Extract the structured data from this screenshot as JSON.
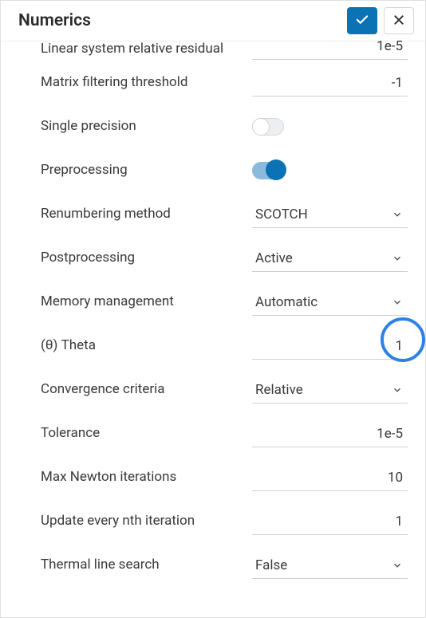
{
  "header": {
    "title": "Numerics"
  },
  "rows": {
    "linear_residual": {
      "label": "Linear system relative residual",
      "value": "1e-5"
    },
    "matrix_filter": {
      "label": "Matrix filtering threshold",
      "value": "-1"
    },
    "single_precision": {
      "label": "Single precision"
    },
    "preprocessing": {
      "label": "Preprocessing"
    },
    "renumbering": {
      "label": "Renumbering method",
      "value": "SCOTCH"
    },
    "postprocessing": {
      "label": "Postprocessing",
      "value": "Active"
    },
    "memory": {
      "label": "Memory management",
      "value": "Automatic"
    },
    "theta": {
      "label": "(θ) Theta",
      "value": "1"
    },
    "convergence": {
      "label": "Convergence criteria",
      "value": "Relative"
    },
    "tolerance": {
      "label": "Tolerance",
      "value": "1e-5"
    },
    "max_newton": {
      "label": "Max Newton iterations",
      "value": "10"
    },
    "update_nth": {
      "label": "Update every nth iteration",
      "value": "1"
    },
    "thermal_line": {
      "label": "Thermal line search",
      "value": "False"
    }
  }
}
